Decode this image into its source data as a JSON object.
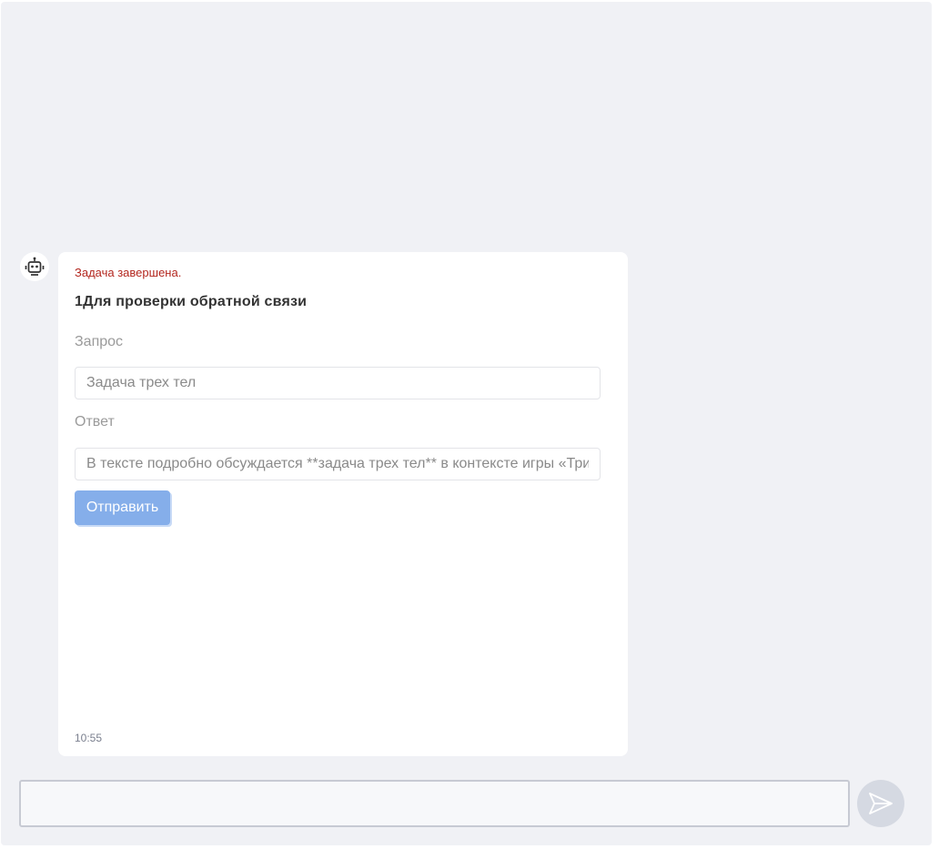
{
  "message": {
    "status": "Задача завершена.",
    "title": "1Для проверки обратной связи",
    "query_label": "Запрос",
    "query_value": "Задача трех тел",
    "answer_label": "Ответ",
    "answer_value": "В тексте подробно обсуждается **задача трех тел** в контексте игры «Три",
    "submit_label": "Отправить",
    "time": "10:55"
  },
  "icons": {
    "avatar": "robot-icon",
    "send": "send-arrow-icon"
  },
  "colors": {
    "background": "#f0f1f5",
    "status": "#b3261e",
    "submit": "#85aeea",
    "send_button": "#d5d9e2"
  }
}
